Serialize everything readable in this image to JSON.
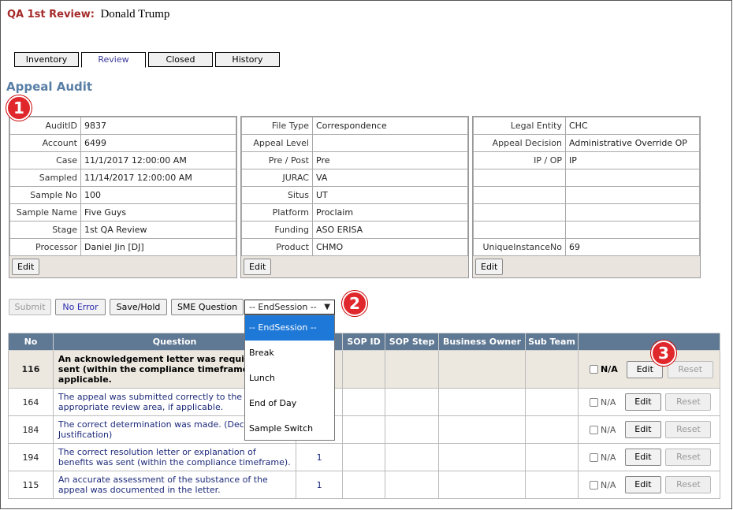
{
  "header": {
    "label": "QA 1st Review:",
    "name": "Donald Trump"
  },
  "tabs": [
    {
      "label": "Inventory",
      "active": false
    },
    {
      "label": "Review",
      "active": true
    },
    {
      "label": "Closed",
      "active": false
    },
    {
      "label": "History",
      "active": false
    }
  ],
  "section_title": "Appeal Audit",
  "badges": [
    "1",
    "2",
    "3"
  ],
  "panel1": {
    "rows": [
      {
        "k": "AuditID",
        "v": "9837"
      },
      {
        "k": "Account",
        "v": "6499"
      },
      {
        "k": "Case",
        "v": "11/1/2017 12:00:00 AM"
      },
      {
        "k": "Sampled",
        "v": "11/14/2017 12:00:00 AM"
      },
      {
        "k": "Sample No",
        "v": "100"
      },
      {
        "k": "Sample Name",
        "v": "Five Guys"
      },
      {
        "k": "Stage",
        "v": "1st QA Review"
      },
      {
        "k": "Processor",
        "v": "Daniel Jin [DJ]"
      }
    ],
    "edit_label": "Edit"
  },
  "panel2": {
    "rows": [
      {
        "k": "File Type",
        "v": "Correspondence"
      },
      {
        "k": "Appeal Level",
        "v": ""
      },
      {
        "k": "Pre / Post",
        "v": "Pre"
      },
      {
        "k": "JURAC",
        "v": "VA"
      },
      {
        "k": "Situs",
        "v": "UT"
      },
      {
        "k": "Platform",
        "v": "Proclaim"
      },
      {
        "k": "Funding",
        "v": "ASO ERISA"
      },
      {
        "k": "Product",
        "v": "CHMO"
      }
    ],
    "edit_label": "Edit"
  },
  "panel3": {
    "rows": [
      {
        "k": "Legal Entity",
        "v": "CHC"
      },
      {
        "k": "Appeal Decision",
        "v": "Administrative Override OP"
      },
      {
        "k": "IP / OP",
        "v": "IP"
      },
      {
        "k": "",
        "v": ""
      },
      {
        "k": "",
        "v": ""
      },
      {
        "k": "",
        "v": ""
      },
      {
        "k": "",
        "v": ""
      },
      {
        "k": "UniqueInstanceNo",
        "v": "69"
      }
    ],
    "edit_label": "Edit"
  },
  "actions": {
    "submit": "Submit",
    "no_error": "No Error",
    "save_hold": "Save/Hold",
    "sme_question": "SME Question"
  },
  "session_select": {
    "value": "-- EndSession --",
    "options": [
      "-- EndSession --",
      "Break",
      "Lunch",
      "End of Day",
      "Sample Switch"
    ]
  },
  "grid": {
    "headers": [
      "No",
      "Question",
      "",
      "SOP ID",
      "SOP Step",
      "Business Owner",
      "Sub Team",
      ""
    ],
    "rows": [
      {
        "no": "116",
        "question": "An acknowledgement letter was required and sent (within the compliance timeframe), if applicable.",
        "c": ""
      },
      {
        "no": "164",
        "question": "The appeal was submitted correctly to the appropriate review area, if applicable.",
        "c": ""
      },
      {
        "no": "184",
        "question": "The correct determination was made. (Decision Justification)",
        "c": ""
      },
      {
        "no": "194",
        "question": "The correct resolution letter or explanation of benefits was sent (within the compliance timeframe).",
        "c": "1"
      },
      {
        "no": "115",
        "question": "An accurate assessment of the substance of the appeal was documented in the letter.",
        "c": "1"
      }
    ],
    "na_label": "N/A",
    "edit_label": "Edit",
    "reset_label": "Reset"
  }
}
